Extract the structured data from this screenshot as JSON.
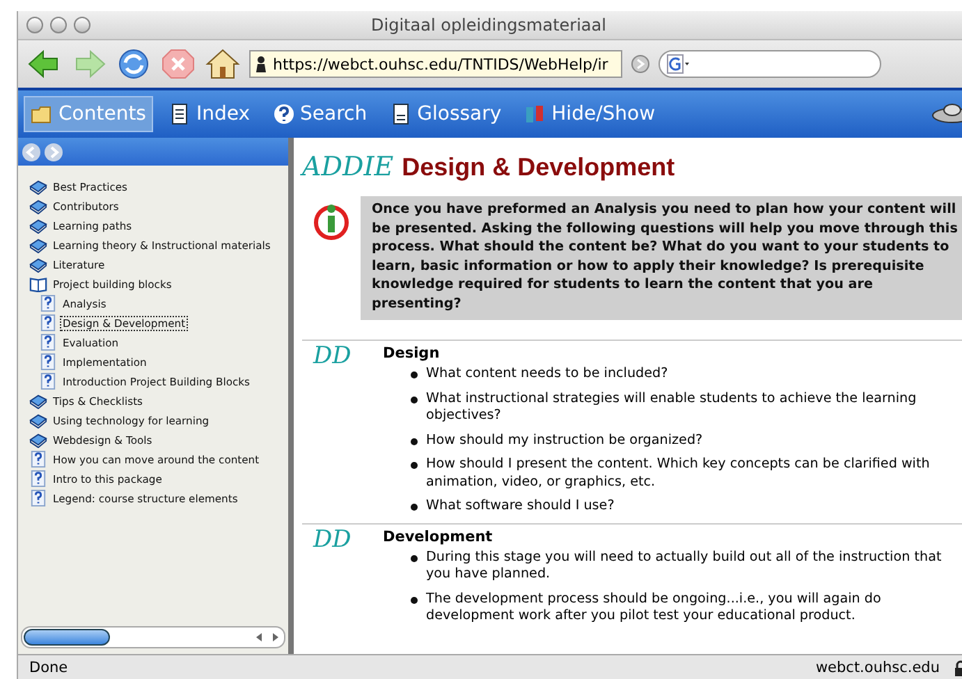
{
  "window": {
    "title": "Digitaal opleidingsmateriaal"
  },
  "toolbar": {
    "url": "https://webct.ouhsc.edu/TNTIDS/WebHelp/ir"
  },
  "nav_tabs": [
    {
      "label": "Contents",
      "selected": true,
      "kind": "contents"
    },
    {
      "label": "Index",
      "selected": false,
      "kind": "index"
    },
    {
      "label": "Search",
      "selected": false,
      "kind": "search"
    },
    {
      "label": "Glossary",
      "selected": false,
      "kind": "glossary"
    },
    {
      "label": "Hide/Show",
      "selected": false,
      "kind": "hideshow"
    }
  ],
  "tree": [
    {
      "label": "Best Practices",
      "kind": "book",
      "selected": false
    },
    {
      "label": "Contributors",
      "kind": "book",
      "selected": false
    },
    {
      "label": "Learning paths",
      "kind": "book",
      "selected": false
    },
    {
      "label": "Learning theory & Instructional materials",
      "kind": "book",
      "selected": false
    },
    {
      "label": "Literature",
      "kind": "book",
      "selected": false
    },
    {
      "label": "Project building blocks",
      "kind": "book",
      "selected": false,
      "expanded": true,
      "children": [
        {
          "label": "Analysis",
          "kind": "page",
          "selected": false
        },
        {
          "label": "Design & Development",
          "kind": "page",
          "selected": true
        },
        {
          "label": "Evaluation",
          "kind": "page",
          "selected": false
        },
        {
          "label": "Implementation",
          "kind": "page",
          "selected": false
        },
        {
          "label": "Introduction Project Building Blocks",
          "kind": "page",
          "selected": false
        }
      ]
    },
    {
      "label": "Tips & Checklists",
      "kind": "book",
      "selected": false
    },
    {
      "label": "Using technology for learning",
      "kind": "book",
      "selected": false
    },
    {
      "label": "Webdesign & Tools",
      "kind": "book",
      "selected": false
    },
    {
      "label": "How you can move around the content",
      "kind": "page",
      "selected": false
    },
    {
      "label": "Intro to this package",
      "kind": "page",
      "selected": false
    },
    {
      "label": "Legend: course structure elements",
      "kind": "page",
      "selected": false
    }
  ],
  "content": {
    "logo": "ADDIE",
    "title": "Design & Development",
    "intro": "Once you have preformed an Analysis you need to plan how your content will be presented. Asking the following questions will help you move through this process. What should the content be? What do you want to your students to learn, basic information or how to apply their knowledge? Is prerequisite knowledge required for students to learn the content that you are presenting?",
    "sections": [
      {
        "mark": "DD",
        "heading": "Design",
        "bullets": [
          "What content needs to be included?",
          "What instructional strategies will enable students to achieve the learning objectives?",
          "How should my instruction be organized?",
          "How should I present the content. Which key concepts can be clarified with animation, video, or graphics, etc.",
          "What software should I use?"
        ]
      },
      {
        "mark": "DD",
        "heading": "Development",
        "bullets": [
          "During this stage you will need to actually build out all of the instruction that you have planned.",
          "The development process should be ongoing...i.e., you will again do development work after you pilot test your educational product."
        ]
      }
    ]
  },
  "status_bar": {
    "text": "Done",
    "host": "webct.ouhsc.edu"
  }
}
